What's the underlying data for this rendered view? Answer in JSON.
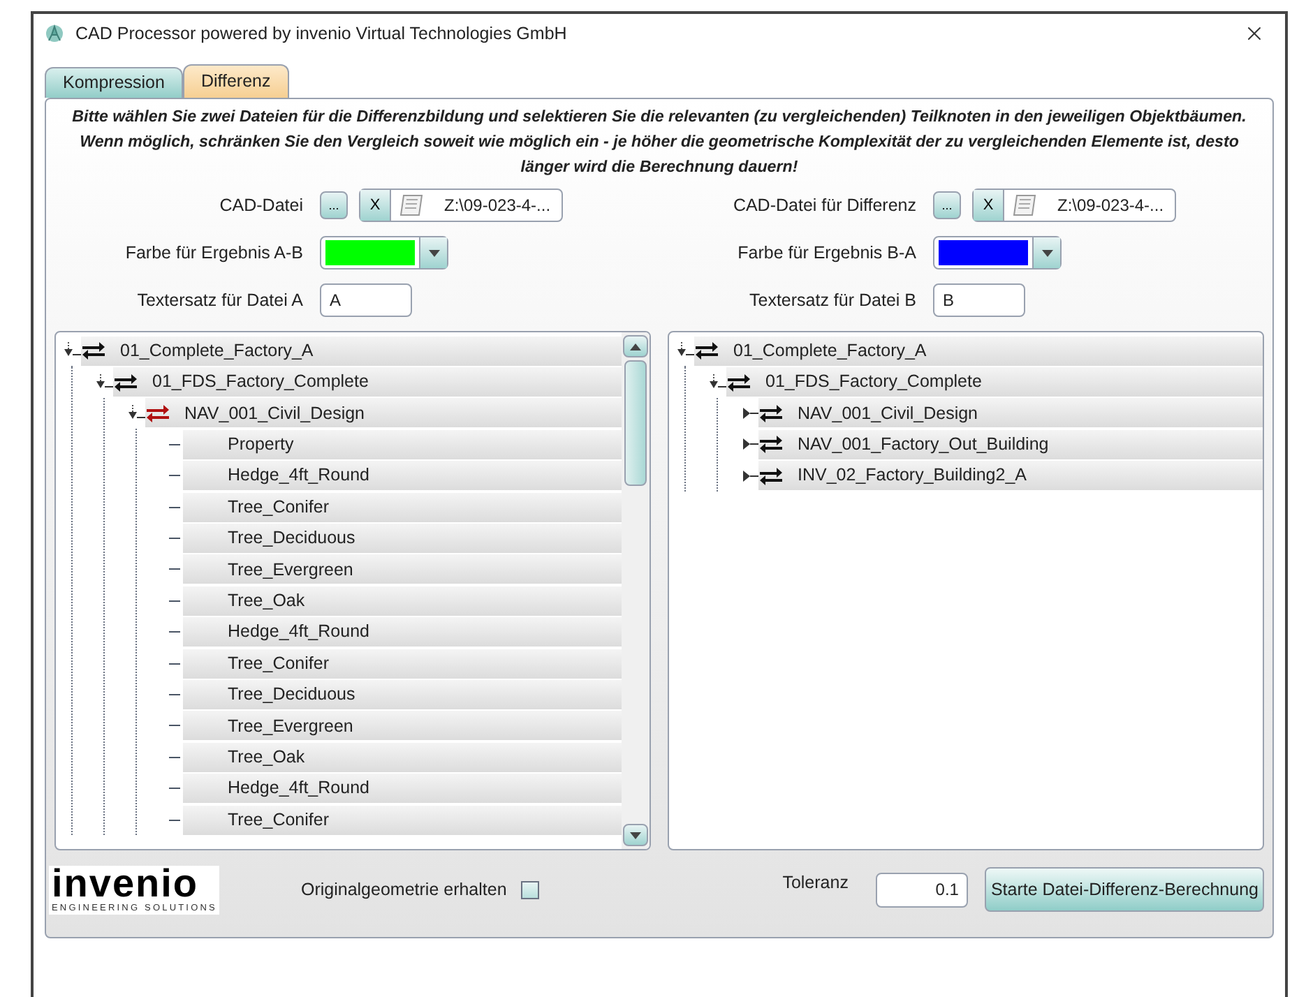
{
  "window": {
    "title": "CAD Processor powered by invenio Virtual Technologies GmbH"
  },
  "tabs": [
    {
      "label": "Kompression",
      "selected": false
    },
    {
      "label": "Differenz",
      "selected": true
    }
  ],
  "instructions": "Bitte wählen Sie zwei Dateien für die Differenzbildung und selektieren Sie die relevanten (zu vergleichenden) Teilknoten in den jeweiligen Objektbäumen. Wenn möglich, schränken Sie den Vergleich soweit wie möglich ein - je höher die geometrische Komplexität der zu vergleichenden Elemente ist, desto länger wird die Berechnung dauern!",
  "sides": [
    {
      "file": {
        "label": "CAD-Datei",
        "browse": "...",
        "clear": "X",
        "path": "Z:\\09-023-4-..."
      },
      "color_field": {
        "label": "Farbe für Ergebnis A-B",
        "color": "#00ff00"
      },
      "text_field": {
        "label": "Textersatz für Datei A",
        "value": "A"
      },
      "tree": [
        {
          "label": "01_Complete_Factory_A",
          "kind": "assembly",
          "expanded": true,
          "highlighted": false,
          "children": [
            {
              "label": "01_FDS_Factory_Complete",
              "kind": "assembly",
              "expanded": true,
              "highlighted": false,
              "children": [
                {
                  "label": "NAV_001_Civil_Design",
                  "kind": "assembly",
                  "expanded": true,
                  "highlighted": true,
                  "children": [
                    {
                      "label": "Property",
                      "kind": "part"
                    },
                    {
                      "label": "Hedge_4ft_Round",
                      "kind": "part"
                    },
                    {
                      "label": "Tree_Conifer",
                      "kind": "part"
                    },
                    {
                      "label": "Tree_Deciduous",
                      "kind": "part"
                    },
                    {
                      "label": "Tree_Evergreen",
                      "kind": "part"
                    },
                    {
                      "label": "Tree_Oak",
                      "kind": "part"
                    },
                    {
                      "label": "Hedge_4ft_Round",
                      "kind": "part"
                    },
                    {
                      "label": "Tree_Conifer",
                      "kind": "part"
                    },
                    {
                      "label": "Tree_Deciduous",
                      "kind": "part"
                    },
                    {
                      "label": "Tree_Evergreen",
                      "kind": "part"
                    },
                    {
                      "label": "Tree_Oak",
                      "kind": "part"
                    },
                    {
                      "label": "Hedge_4ft_Round",
                      "kind": "part"
                    },
                    {
                      "label": "Tree_Conifer",
                      "kind": "part"
                    }
                  ]
                }
              ]
            }
          ]
        }
      ],
      "scrollbar": true
    },
    {
      "file": {
        "label": "CAD-Datei für Differenz",
        "browse": "...",
        "clear": "X",
        "path": "Z:\\09-023-4-..."
      },
      "color_field": {
        "label": "Farbe für Ergebnis B-A",
        "color": "#0000ff"
      },
      "text_field": {
        "label": "Textersatz für Datei B",
        "value": "B"
      },
      "tree": [
        {
          "label": "01_Complete_Factory_A",
          "kind": "assembly",
          "expanded": true,
          "highlighted": false,
          "children": [
            {
              "label": "01_FDS_Factory_Complete",
              "kind": "assembly",
              "expanded": true,
              "highlighted": false,
              "children": [
                {
                  "label": "NAV_001_Civil_Design",
                  "kind": "assembly",
                  "expanded": false,
                  "highlighted": false
                },
                {
                  "label": "NAV_001_Factory_Out_Building",
                  "kind": "assembly",
                  "expanded": false,
                  "highlighted": false
                },
                {
                  "label": "INV_02_Factory_Building2_A",
                  "kind": "assembly",
                  "expanded": false,
                  "highlighted": false
                }
              ]
            }
          ]
        }
      ],
      "scrollbar": false
    }
  ],
  "logo": {
    "name": "invenio",
    "tagline": "ENGINEERING SOLUTIONS"
  },
  "keep_geometry": {
    "label": "Originalgeometrie erhalten",
    "checked": false
  },
  "tolerance": {
    "label": "Toleranz",
    "value": "0.1"
  },
  "start_button": "Starte Datei-Differenz-Berechnung"
}
